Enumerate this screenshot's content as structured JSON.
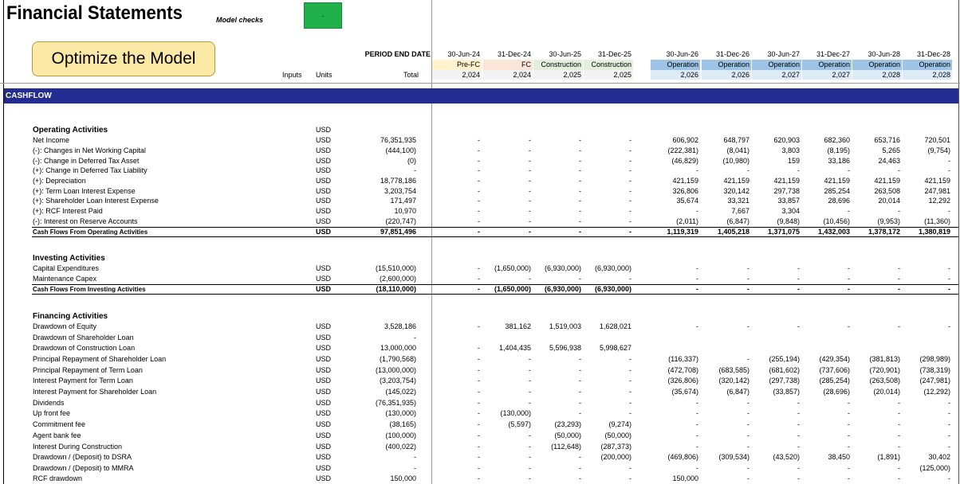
{
  "title": "Financial Statements",
  "model_checks": {
    "label": "Model checks",
    "value": "-",
    "status_color": "#1fb04a"
  },
  "optimize_button": {
    "label": "Optimize the Model"
  },
  "headers": {
    "period_end_date": "PERIOD END DATE",
    "inputs": "Inputs",
    "units": "Units",
    "total": "Total"
  },
  "periods": [
    {
      "date": "30-Jun-24",
      "phase": "Pre-FC",
      "year": "2,024",
      "phase_color": "#fff2cc"
    },
    {
      "date": "31-Dec-24",
      "phase": "FC",
      "year": "2,024",
      "phase_color": "#fce4d6"
    },
    {
      "date": "30-Jun-25",
      "phase": "Construction",
      "year": "2,025",
      "phase_color": "#e2efda"
    },
    {
      "date": "31-Dec-25",
      "phase": "Construction",
      "year": "2,025",
      "phase_color": "#e2efda"
    },
    {
      "date": "30-Jun-26",
      "phase": "Operation",
      "year": "2,026",
      "phase_color": "#9dc3e6"
    },
    {
      "date": "31-Dec-26",
      "phase": "Operation",
      "year": "2,026",
      "phase_color": "#9dc3e6"
    },
    {
      "date": "30-Jun-27",
      "phase": "Operation",
      "year": "2,027",
      "phase_color": "#9dc3e6"
    },
    {
      "date": "31-Dec-27",
      "phase": "Operation",
      "year": "2,027",
      "phase_color": "#9dc3e6"
    },
    {
      "date": "30-Jun-28",
      "phase": "Operation",
      "year": "2,028",
      "phase_color": "#9dc3e6"
    },
    {
      "date": "31-Dec-28",
      "phase": "Operation",
      "year": "2,028",
      "phase_color": "#9dc3e6"
    }
  ],
  "section": {
    "label": "CASHFLOW"
  },
  "rows": [
    {
      "kind": "group",
      "label": "Operating Activities",
      "units": "USD",
      "total": "",
      "values": []
    },
    {
      "kind": "line",
      "label": "Net Income",
      "units": "USD",
      "total": "76,351,935",
      "values": [
        "-",
        "-",
        "-",
        "-",
        "606,902",
        "648,797",
        "620,903",
        "682,360",
        "653,716",
        "720,501"
      ]
    },
    {
      "kind": "line",
      "label": "(-): Changes in Net Working Capital",
      "units": "USD",
      "total": "(444,100)",
      "values": [
        "-",
        "-",
        "-",
        "-",
        "(222,381)",
        "(8,041)",
        "3,803",
        "(8,195)",
        "5,265",
        "(9,754)"
      ]
    },
    {
      "kind": "line",
      "label": "(-): Change in Deferred Tax Asset",
      "units": "USD",
      "total": "(0)",
      "values": [
        "-",
        "-",
        "-",
        "-",
        "(46,829)",
        "(10,980)",
        "159",
        "33,186",
        "24,463",
        "-"
      ]
    },
    {
      "kind": "line",
      "label": "(+): Change in Deferred Tax Liability",
      "units": "USD",
      "total": "-",
      "values": [
        "-",
        "-",
        "-",
        "-",
        "-",
        "-",
        "-",
        "-",
        "-",
        "-"
      ]
    },
    {
      "kind": "line",
      "label": "(+): Depreciation",
      "units": "USD",
      "total": "18,778,186",
      "values": [
        "-",
        "-",
        "-",
        "-",
        "421,159",
        "421,159",
        "421,159",
        "421,159",
        "421,159",
        "421,159"
      ]
    },
    {
      "kind": "line",
      "label": "(+): Term Loan Interest Expense",
      "units": "USD",
      "total": "3,203,754",
      "values": [
        "-",
        "-",
        "-",
        "-",
        "326,806",
        "320,142",
        "297,738",
        "285,254",
        "263,508",
        "247,981"
      ]
    },
    {
      "kind": "line",
      "label": "(+): Shareholder Loan Interest Expense",
      "units": "USD",
      "total": "171,497",
      "values": [
        "-",
        "-",
        "-",
        "-",
        "35,674",
        "33,321",
        "33,857",
        "28,696",
        "20,014",
        "12,292"
      ]
    },
    {
      "kind": "line",
      "label": "(+): RCF Interest Paid",
      "units": "USD",
      "total": "10,970",
      "values": [
        "-",
        "-",
        "-",
        "-",
        "-",
        "7,667",
        "3,304",
        "-",
        "-",
        "-"
      ]
    },
    {
      "kind": "line",
      "label": "(-): Interest on Reserve Accounts",
      "units": "USD",
      "total": "(220,747)",
      "values": [
        "-",
        "-",
        "-",
        "-",
        "(2,011)",
        "(6,847)",
        "(9,848)",
        "(10,456)",
        "(9,953)",
        "(11,360)"
      ]
    },
    {
      "kind": "subtotal",
      "label": "Cash Flows From Operating Activities",
      "units": "USD",
      "total": "97,851,496",
      "values": [
        "-",
        "-",
        "-",
        "-",
        "1,119,319",
        "1,405,218",
        "1,371,075",
        "1,432,003",
        "1,378,172",
        "1,380,819"
      ]
    },
    {
      "kind": "group",
      "label": "Investing Activities",
      "units": "",
      "total": "",
      "values": []
    },
    {
      "kind": "line",
      "label": "Capital Expenditures",
      "units": "USD",
      "total": "(15,510,000)",
      "values": [
        "-",
        "(1,650,000)",
        "(6,930,000)",
        "(6,930,000)",
        "-",
        "-",
        "-",
        "-",
        "-",
        "-"
      ]
    },
    {
      "kind": "line",
      "label": "Maintenance Capex",
      "units": "USD",
      "total": "(2,600,000)",
      "values": [
        "-",
        "-",
        "-",
        "-",
        "-",
        "-",
        "-",
        "-",
        "-",
        "-"
      ]
    },
    {
      "kind": "subtotal",
      "label": "Cash Flows From Investing Activities",
      "units": "USD",
      "total": "(18,110,000)",
      "values": [
        "-",
        "(1,650,000)",
        "(6,930,000)",
        "(6,930,000)",
        "-",
        "-",
        "-",
        "-",
        "-",
        "-"
      ]
    },
    {
      "kind": "group",
      "label": "Financing Activities",
      "units": "",
      "total": "",
      "values": []
    },
    {
      "kind": "line",
      "label": "Drawdown of Equity",
      "units": "USD",
      "total": "3,528,186",
      "values": [
        "-",
        "381,162",
        "1,519,003",
        "1,628,021",
        "-",
        "-",
        "-",
        "-",
        "-",
        "-"
      ]
    },
    {
      "kind": "line",
      "label": "Drawdown of Shareholder Loan",
      "units": "USD",
      "total": "-",
      "values": [
        "",
        "",
        "",
        "",
        "",
        "",
        "",
        "",
        "",
        ""
      ]
    },
    {
      "kind": "line",
      "label": "Drawdown of Construction Loan",
      "units": "USD",
      "total": "13,000,000",
      "values": [
        "-",
        "1,404,435",
        "5,596,938",
        "5,998,627",
        "",
        "",
        "",
        "",
        "",
        ""
      ]
    },
    {
      "kind": "line",
      "label": "Principal Repayment of Shareholder Loan",
      "units": "USD",
      "total": "(1,790,568)",
      "values": [
        "-",
        "-",
        "-",
        "-",
        "(116,337)",
        "-",
        "(255,194)",
        "(429,354)",
        "(381,813)",
        "(298,989)"
      ]
    },
    {
      "kind": "line",
      "label": "Principal Repayment of Term Loan",
      "units": "USD",
      "total": "(13,000,000)",
      "values": [
        "-",
        "-",
        "-",
        "-",
        "(472,708)",
        "(683,585)",
        "(681,602)",
        "(737,606)",
        "(720,901)",
        "(738,319)"
      ]
    },
    {
      "kind": "line",
      "label": "Interest Payment for Term Loan",
      "units": "USD",
      "total": "(3,203,754)",
      "values": [
        "-",
        "-",
        "-",
        "-",
        "(326,806)",
        "(320,142)",
        "(297,738)",
        "(285,254)",
        "(263,508)",
        "(247,981)"
      ]
    },
    {
      "kind": "line",
      "label": "Interest Payment for Shareholder Loan",
      "units": "USD",
      "total": "(145,022)",
      "values": [
        "-",
        "-",
        "-",
        "-",
        "(35,674)",
        "(6,847)",
        "(33,857)",
        "(28,696)",
        "(20,014)",
        "(12,292)"
      ]
    },
    {
      "kind": "line",
      "label": "Dividends",
      "units": "USD",
      "total": "(76,351,935)",
      "values": [
        "-",
        "-",
        "-",
        "-",
        "-",
        "-",
        "-",
        "-",
        "-",
        "-"
      ]
    },
    {
      "kind": "line",
      "label": "Up front fee",
      "units": "USD",
      "total": "(130,000)",
      "values": [
        "-",
        "(130,000)",
        "-",
        "-",
        "-",
        "-",
        "-",
        "-",
        "-",
        "-"
      ]
    },
    {
      "kind": "line",
      "label": "Commitment fee",
      "units": "USD",
      "total": "(38,165)",
      "values": [
        "-",
        "(5,597)",
        "(23,293)",
        "(9,274)",
        "-",
        "-",
        "-",
        "-",
        "-",
        "-"
      ]
    },
    {
      "kind": "line",
      "label": "Agent bank fee",
      "units": "USD",
      "total": "(100,000)",
      "values": [
        "-",
        "-",
        "(50,000)",
        "(50,000)",
        "-",
        "-",
        "-",
        "-",
        "-",
        "-"
      ]
    },
    {
      "kind": "line",
      "label": "Interest During Construction",
      "units": "USD",
      "total": "(400,022)",
      "values": [
        "-",
        "-",
        "(112,648)",
        "(287,373)",
        "-",
        "-",
        "-",
        "-",
        "-",
        "-"
      ]
    },
    {
      "kind": "line",
      "label": "Drawdown / (Deposit) to DSRA",
      "units": "USD",
      "total": "-",
      "values": [
        "-",
        "-",
        "-",
        "(200,000)",
        "(469,806)",
        "(309,534)",
        "(43,520)",
        "38,450",
        "(1,891)",
        "30,402"
      ]
    },
    {
      "kind": "line",
      "label": "Drawdown / (Deposit) to MMRA",
      "units": "USD",
      "total": "-",
      "values": [
        "-",
        "-",
        "-",
        "-",
        "-",
        "-",
        "-",
        "-",
        "-",
        "(125,000)"
      ]
    },
    {
      "kind": "line",
      "label": "RCF drawdown",
      "units": "USD",
      "total": "150,000",
      "values": [
        "-",
        "-",
        "-",
        "-",
        "150,000",
        "-",
        "-",
        "-",
        "-",
        "-"
      ]
    }
  ]
}
